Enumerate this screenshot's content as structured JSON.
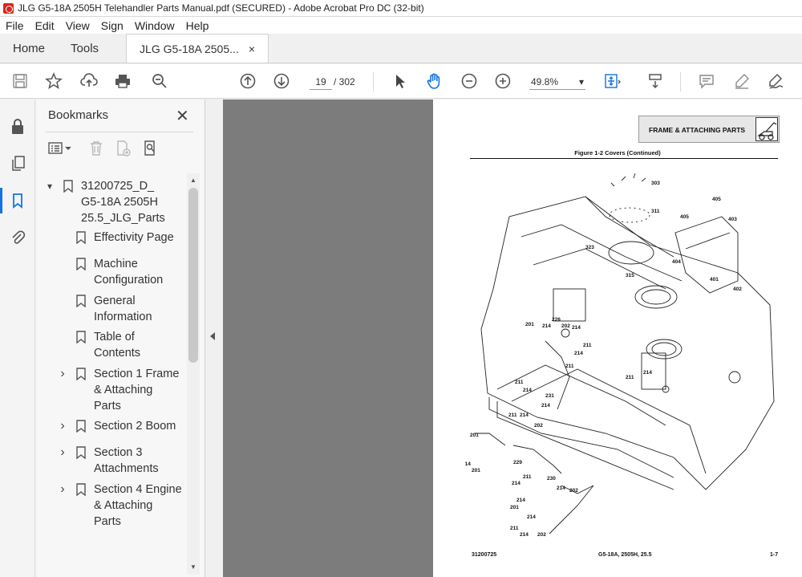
{
  "window": {
    "title": "JLG G5-18A 2505H Telehandler Parts Manual.pdf (SECURED) - Adobe Acrobat Pro DC (32-bit)"
  },
  "menu": [
    "File",
    "Edit",
    "View",
    "Sign",
    "Window",
    "Help"
  ],
  "tabs": {
    "home": "Home",
    "tools": "Tools",
    "document": "JLG G5-18A 2505...",
    "close_glyph": "×"
  },
  "toolbar": {
    "current_page": "19",
    "page_total": "/ 302",
    "zoom": "49.8%",
    "zoom_caret": "▾"
  },
  "bookmarks_panel": {
    "title": "Bookmarks",
    "close_glyph": "✕",
    "items": [
      {
        "label": "31200725_D_\nG5-18A 2505H\n25.5_JLG_Parts",
        "caret": "▾",
        "level": 0
      },
      {
        "label": "Effectivity Page",
        "caret": "",
        "level": 1
      },
      {
        "label": "Machine\nConfiguration",
        "caret": "",
        "level": 1
      },
      {
        "label": "General\nInformation",
        "caret": "",
        "level": 1
      },
      {
        "label": "Table of\nContents",
        "caret": "",
        "level": 1
      },
      {
        "label": "Section 1 Frame\n& Attaching\nParts",
        "caret": "›",
        "level": 1
      },
      {
        "label": "Section 2 Boom",
        "caret": "›",
        "level": 1
      },
      {
        "label": "Section 3\nAttachments",
        "caret": "›",
        "level": 1
      },
      {
        "label": "Section 4 Engine\n& Attaching\nParts",
        "caret": "›",
        "level": 1
      }
    ]
  },
  "document_page": {
    "header": "FRAME & ATTACHING PARTS",
    "figure_caption": "Figure 1-2 Covers (Continued)",
    "footer_left": "31200725",
    "footer_center": "G5-18A, 2505H, 25.5",
    "footer_right": "1-7",
    "callouts": [
      "303",
      "311",
      "323",
      "315",
      "405",
      "405",
      "403",
      "404",
      "401",
      "402",
      "201",
      "214",
      "226",
      "202",
      "214",
      "211",
      "214",
      "211",
      "211",
      "214",
      "231",
      "214",
      "211",
      "214",
      "202",
      "211",
      "214",
      "201",
      "214",
      "201",
      "229",
      "211",
      "214",
      "230",
      "214",
      "202",
      "214",
      "201",
      "214",
      "211",
      "214",
      "202"
    ]
  }
}
